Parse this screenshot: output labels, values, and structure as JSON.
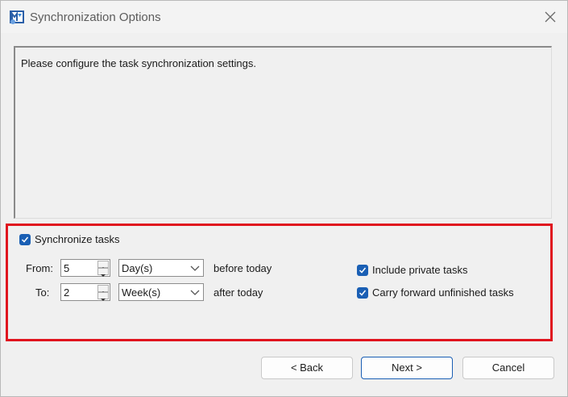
{
  "window": {
    "title": "Synchronization Options"
  },
  "description": "Please configure the task synchronization settings.",
  "sync": {
    "label": "Synchronize tasks",
    "checked": true,
    "from": {
      "label": "From:",
      "value": "5",
      "unit": "Day(s)",
      "suffix": "before today"
    },
    "to": {
      "label": "To:",
      "value": "2",
      "unit": "Week(s)",
      "suffix": "after today"
    },
    "include_private": {
      "label": "Include private tasks",
      "checked": true
    },
    "carry_forward": {
      "label": "Carry forward unfinished tasks",
      "checked": true
    }
  },
  "buttons": {
    "back": "< Back",
    "next": "Next >",
    "cancel": "Cancel"
  },
  "colors": {
    "accent": "#1a5fb4",
    "highlight": "#e0141e"
  }
}
